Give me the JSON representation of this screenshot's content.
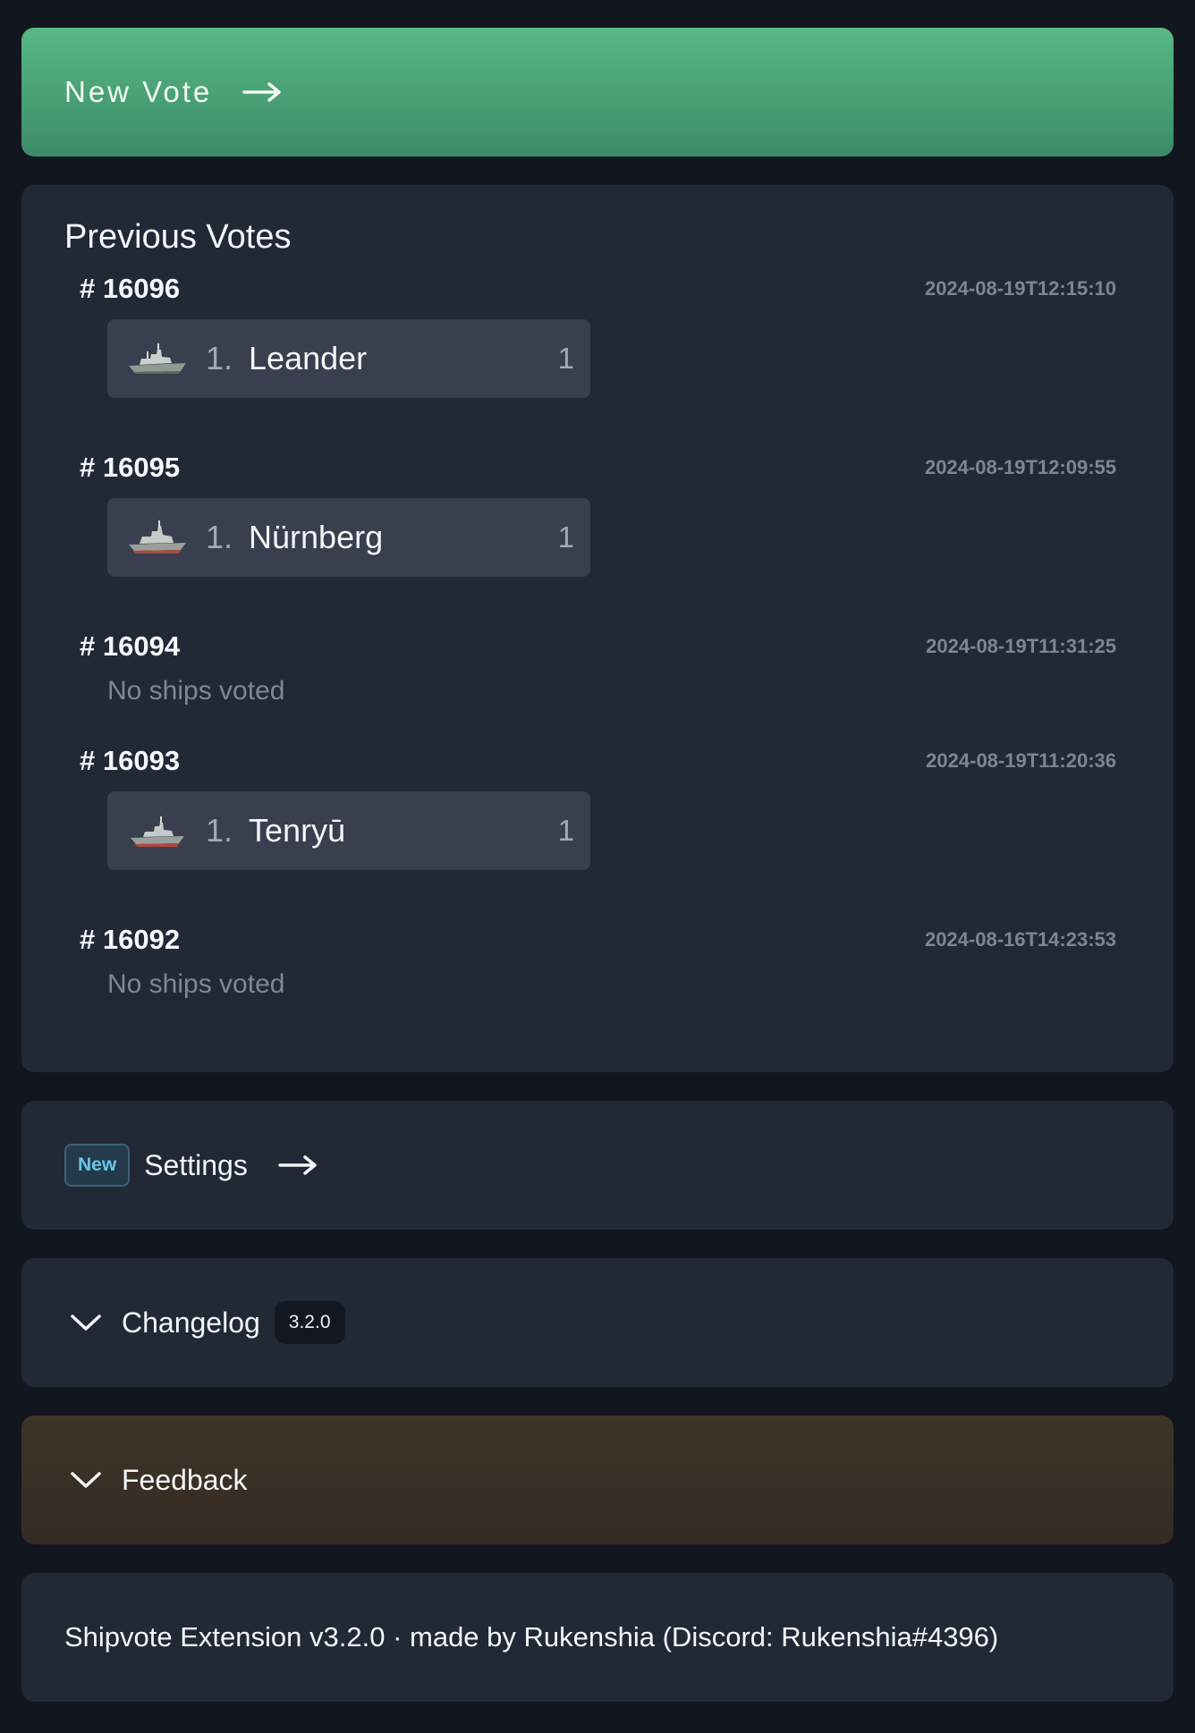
{
  "new_vote": {
    "label": "New Vote"
  },
  "previous_votes": {
    "title": "Previous Votes",
    "votes": [
      {
        "id": "# 16096",
        "time": "2024-08-19T12:15:10",
        "ships": [
          {
            "rank": "1.",
            "name": "Leander",
            "count": "1",
            "icon": "cruiser-ship-icon"
          }
        ]
      },
      {
        "id": "# 16095",
        "time": "2024-08-19T12:09:55",
        "ships": [
          {
            "rank": "1.",
            "name": "Nürnberg",
            "count": "1",
            "icon": "cruiser-ship-icon"
          }
        ]
      },
      {
        "id": "# 16094",
        "time": "2024-08-19T11:31:25",
        "empty_text": "No ships voted"
      },
      {
        "id": "# 16093",
        "time": "2024-08-19T11:20:36",
        "ships": [
          {
            "rank": "1.",
            "name": "Tenryū",
            "count": "1",
            "icon": "cruiser-ship-icon"
          }
        ]
      },
      {
        "id": "# 16092",
        "time": "2024-08-16T14:23:53",
        "empty_text": "No ships voted"
      }
    ]
  },
  "settings": {
    "badge": "New",
    "label": "Settings"
  },
  "changelog": {
    "label": "Changelog",
    "version": "3.2.0"
  },
  "feedback": {
    "label": "Feedback"
  },
  "footer": {
    "text": "Shipvote Extension v3.2.0 · made by Rukenshia (Discord: Rukenshia#4396)"
  },
  "colors": {
    "page_bg": "#12161f",
    "card_bg": "#212836",
    "new_vote_green": "#57b985",
    "feedback_brown": "#3d3527",
    "badge_blue": "#6ac6e8"
  }
}
